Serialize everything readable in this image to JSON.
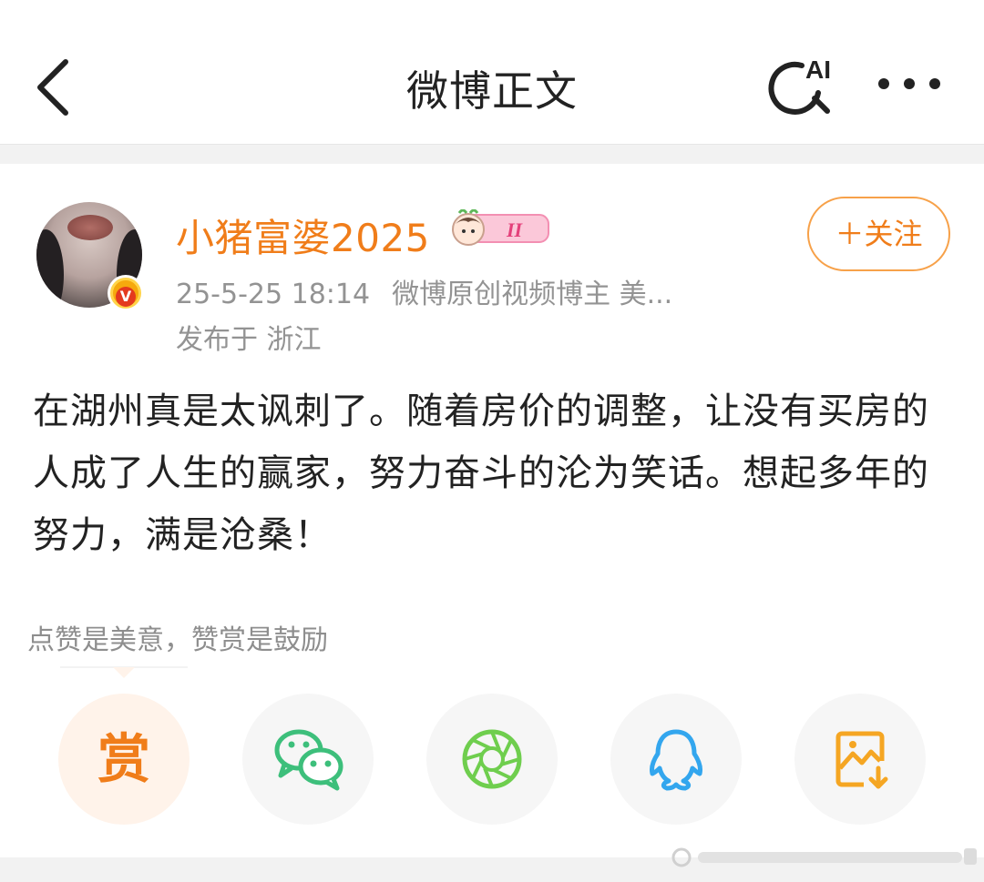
{
  "navbar": {
    "title": "微博正文",
    "back_icon": "chevron-left-icon",
    "ai_search_icon": "ai-search-icon",
    "ai_label": "AI",
    "more_icon": "more-dots-icon"
  },
  "post": {
    "author": {
      "name": "小猪富婆2025",
      "avatar": "avatar",
      "verified_icon": "verified-v-icon",
      "level_badge_icon": "level-badge-icon",
      "level_label": "II"
    },
    "timestamp": "25-5-25 18:14",
    "source": "微博原创视频博主 美...",
    "location": "发布于 浙江",
    "follow_label": "＋关注",
    "text": "在湖州真是太讽刺了。随着房价的调整，让没有买房的人成了人生的赢家，努力奋斗的沦为笑话。想起多年的努力，满是沧桑！"
  },
  "reward": {
    "hint": "点赞是美意，赞赏是鼓励",
    "button_label": "赏"
  },
  "share": {
    "items": [
      {
        "name": "reward-button"
      },
      {
        "name": "wechat-share-icon"
      },
      {
        "name": "moments-share-icon"
      },
      {
        "name": "qq-share-icon"
      },
      {
        "name": "save-image-icon"
      }
    ]
  },
  "colors": {
    "accent": "#f07d1a",
    "wechat": "#3dbf7b",
    "moments": "#6fce4e",
    "qq": "#33a6ee",
    "save": "#f5a623",
    "meta_text": "#939393"
  }
}
